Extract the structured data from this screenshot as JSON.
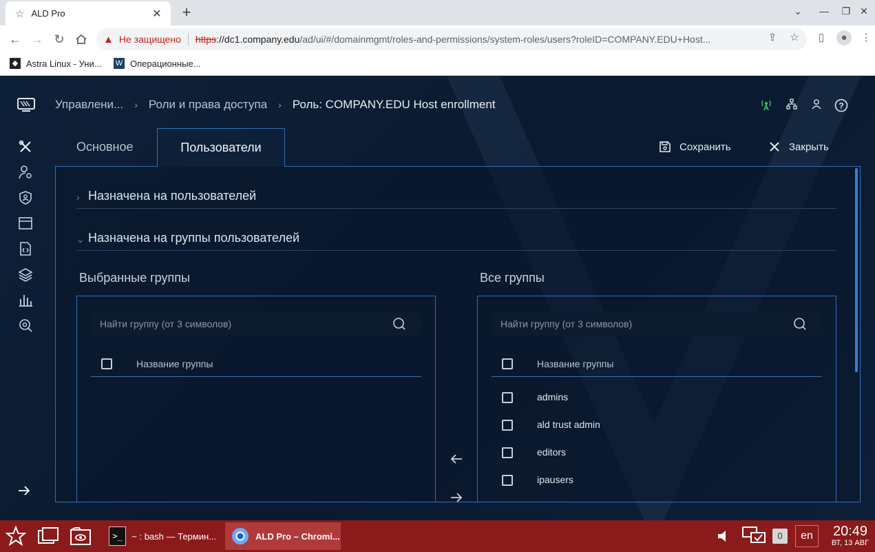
{
  "browser": {
    "tab_title": "ALD Pro",
    "security_text": "Не защищено",
    "url_scheme": "https",
    "url_host": "://dc1.company.edu",
    "url_path": "/ad/ui/#/domainmgmt/roles-and-permissions/system-roles/users?roleID=COMPANY.EDU+Host...",
    "bookmarks": [
      {
        "label": "Astra Linux - Уни..."
      },
      {
        "label": "Операционные..."
      }
    ]
  },
  "header": {
    "breadcrumbs": [
      "Управлени...",
      "Роли и права доступа",
      "Роль: COMPANY.EDU Host enrollment"
    ]
  },
  "tabs": {
    "basic": "Основное",
    "users": "Пользователи"
  },
  "actions": {
    "save": "Сохранить",
    "close": "Закрыть"
  },
  "sections": {
    "users": "Назначена на пользователей",
    "groups": "Назначена на группы пользователей"
  },
  "selected": {
    "title": "Выбранные группы",
    "search_placeholder": "Найти группу (от 3 символов)",
    "column": "Название группы"
  },
  "all": {
    "title": "Все группы",
    "search_placeholder": "Найти группу (от 3 символов)",
    "column": "Название группы",
    "rows": [
      "admins",
      "ald trust admin",
      "editors",
      "ipausers"
    ]
  },
  "taskbar": {
    "tasks": [
      {
        "label": "~ : bash — Термин..."
      },
      {
        "label": "ALD Pro – Chromi..."
      }
    ],
    "badge": "0",
    "lang": "en",
    "time": "20:49",
    "date": "ВТ, 13 АВГ"
  },
  "colors": {
    "accent": "#2f6fb8",
    "app_bg": "#0e2038",
    "taskbar": "#8b1a1a"
  }
}
